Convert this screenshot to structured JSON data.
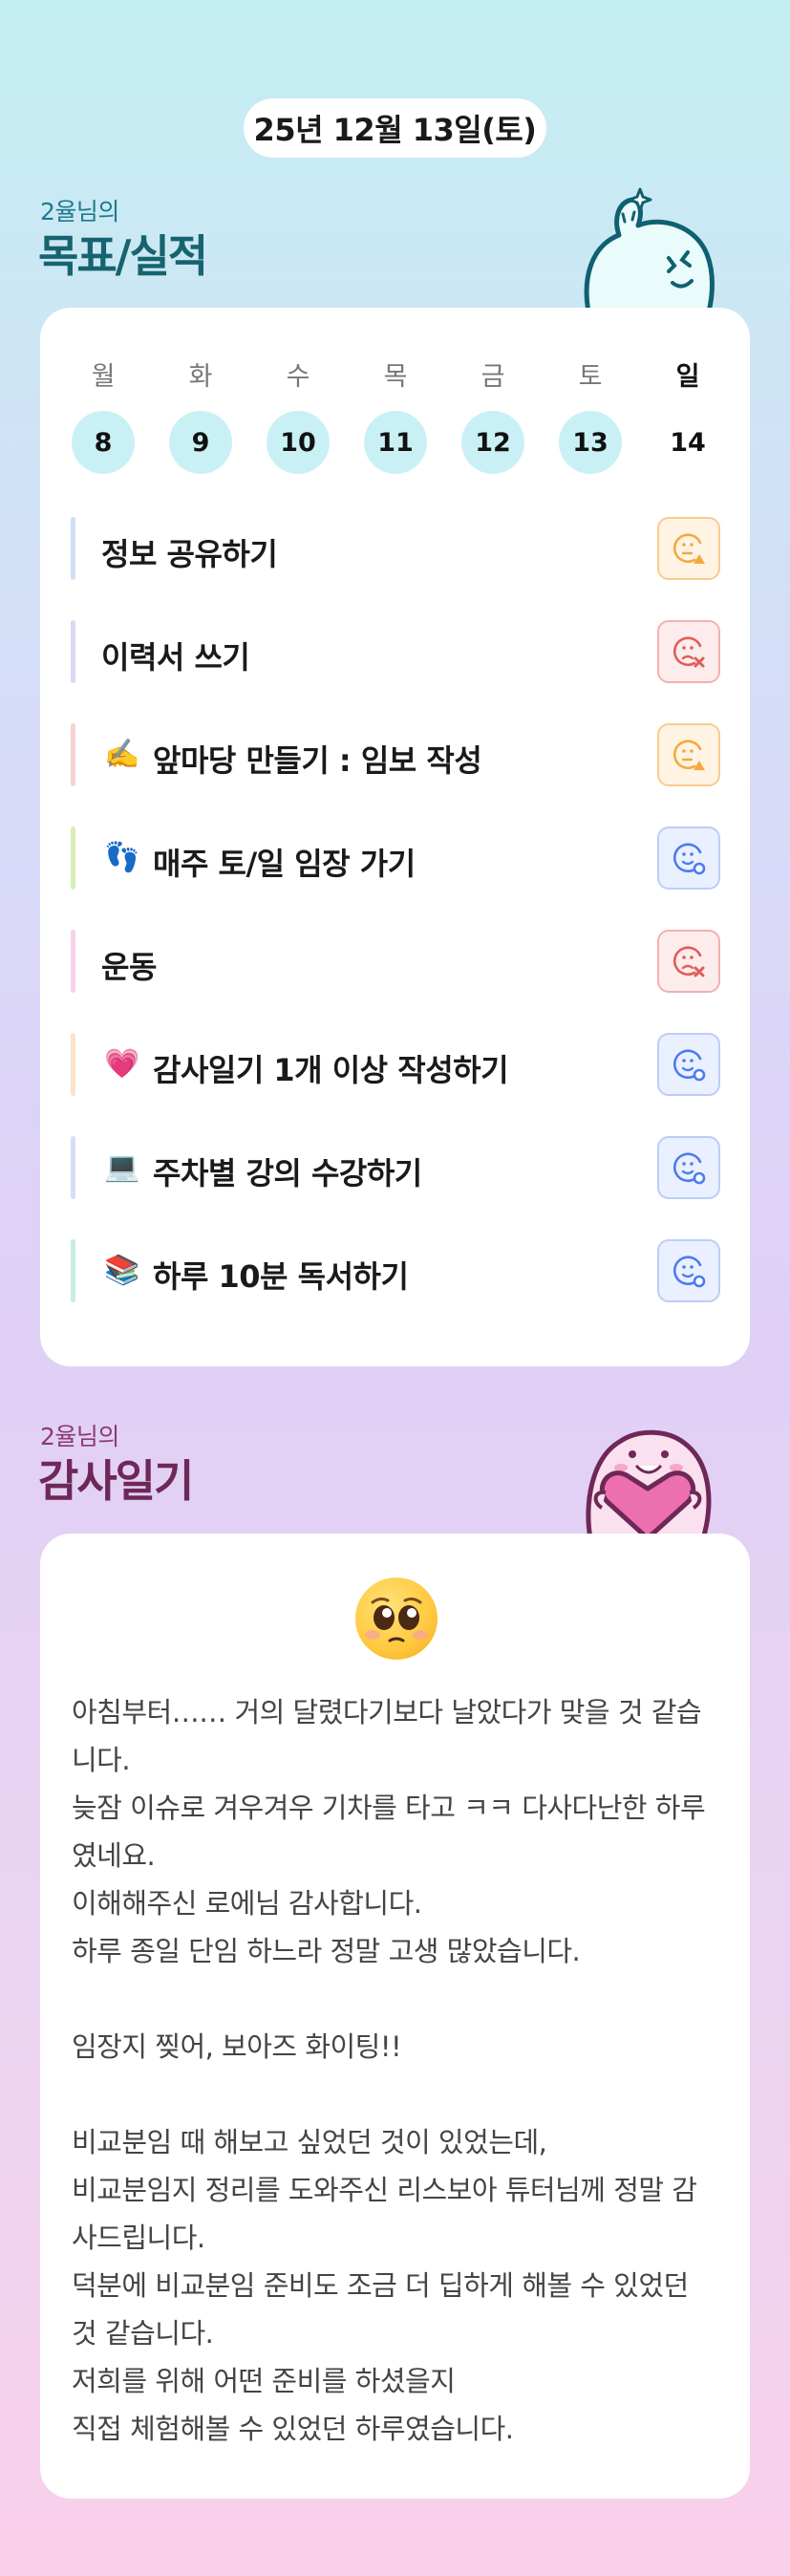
{
  "date": "25년 12월 13일(토)",
  "goals_section": {
    "subtitle": "2율님의",
    "title": "목표/실적"
  },
  "week": {
    "days": [
      {
        "weekday": "월",
        "date": "8",
        "done": true
      },
      {
        "weekday": "화",
        "date": "9",
        "done": true
      },
      {
        "weekday": "수",
        "date": "10",
        "done": true
      },
      {
        "weekday": "목",
        "date": "11",
        "done": true
      },
      {
        "weekday": "금",
        "date": "12",
        "done": true
      },
      {
        "weekday": "토",
        "date": "13",
        "done": true
      },
      {
        "weekday": "일",
        "date": "14",
        "done": false
      }
    ]
  },
  "goals": [
    {
      "emoji": "",
      "label": "정보 공유하기",
      "status": "warning",
      "bar_color": "#cfe0f6"
    },
    {
      "emoji": "",
      "label": "이력서 쓰기",
      "status": "fail",
      "bar_color": "#ddd6f4"
    },
    {
      "emoji": "✍️",
      "label": "앞마당 만들기 : 임보 작성",
      "status": "warning",
      "bar_color": "#f8d2d2"
    },
    {
      "emoji": "👣",
      "label": "매주 토/일 임장 가기",
      "status": "success",
      "bar_color": "#d6efb4"
    },
    {
      "emoji": "",
      "label": "운동",
      "status": "fail",
      "bar_color": "#f6d2e6"
    },
    {
      "emoji": "💗",
      "label": "감사일기 1개 이상 작성하기",
      "status": "success",
      "bar_color": "#fbe3c3"
    },
    {
      "emoji": "💻",
      "label": "주차별 강의 수강하기",
      "status": "success",
      "bar_color": "#d4def6"
    },
    {
      "emoji": "📚",
      "label": "하루 10분 독서하기",
      "status": "success",
      "bar_color": "#c6eedc"
    }
  ],
  "status_colors": {
    "warning": "#f3a93c",
    "fail": "#e35a5a",
    "success": "#4a7cf0"
  },
  "gratitude_section": {
    "subtitle": "2율님의",
    "title": "감사일기"
  },
  "diary": {
    "emoji_icon": "pleading-face",
    "text": "아침부터…… 거의 달렸다기보다 날았다가 맞을 것 같습니다.\n늦잠 이슈로 겨우겨우 기차를 타고 ㅋㅋ 다사다난한 하루였네요.\n이해해주신 로에님 감사합니다.\n하루 종일 단임 하느라 정말 고생 많았습니다.\n\n임장지 찢어, 보아즈 화이팅!!\n\n비교분임 때 해보고 싶었던 것이 있었는데,\n비교분임지 정리를 도와주신 리스보아 튜터님께 정말 감사드립니다.\n덕분에 비교분임 준비도 조금 더 딥하게 해볼 수 있었던 것 같습니다.\n저희를 위해 어떤 준비를 하셨을지\n직접 체험해볼 수 있었던 하루였습니다."
  }
}
